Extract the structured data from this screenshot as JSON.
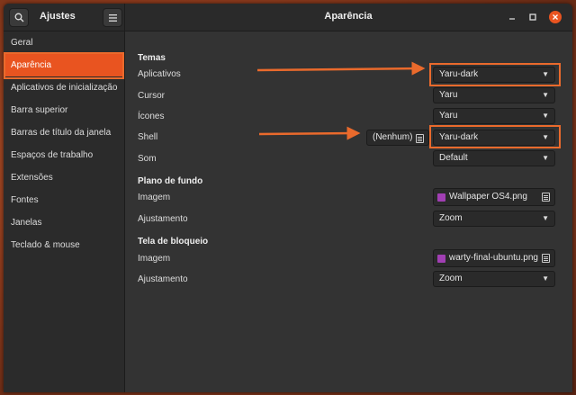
{
  "header": {
    "search_icon": "search-icon",
    "app_title": "Ajustes",
    "menu_icon": "hamburger-menu-icon",
    "page_title": "Aparência",
    "minimize_icon": "minimize-icon",
    "maximize_icon": "maximize-icon",
    "close_icon": "close-icon",
    "accent_color": "#e95420"
  },
  "sidebar": {
    "items": [
      {
        "label": "Geral"
      },
      {
        "label": "Aparência"
      },
      {
        "label": "Aplicativos de inicialização"
      },
      {
        "label": "Barra superior"
      },
      {
        "label": "Barras de título da janela"
      },
      {
        "label": "Espaços de trabalho"
      },
      {
        "label": "Extensões"
      },
      {
        "label": "Fontes"
      },
      {
        "label": "Janelas"
      },
      {
        "label": "Teclado & mouse"
      }
    ],
    "selected": "Aparência"
  },
  "main": {
    "temas": {
      "title": "Temas",
      "aplicativos": {
        "label": "Aplicativos",
        "value": "Yaru-dark"
      },
      "cursor": {
        "label": "Cursor",
        "value": "Yaru"
      },
      "icones": {
        "label": "Ícones",
        "value": "Yaru"
      },
      "shell": {
        "label": "Shell",
        "none_label": "(Nenhum)",
        "value": "Yaru-dark"
      },
      "som": {
        "label": "Som",
        "value": "Default"
      }
    },
    "fundo": {
      "title": "Plano de fundo",
      "imagem": {
        "label": "Imagem",
        "value": "Wallpaper OS4.png"
      },
      "ajustamento": {
        "label": "Ajustamento",
        "value": "Zoom"
      }
    },
    "bloqueio": {
      "title": "Tela de bloqueio",
      "imagem": {
        "label": "Imagem",
        "value": "warty-final-ubuntu.png"
      },
      "ajustamento": {
        "label": "Ajustamento",
        "value": "Zoom"
      }
    }
  },
  "annotations": {
    "highlight_color": "#ea6a2c"
  }
}
